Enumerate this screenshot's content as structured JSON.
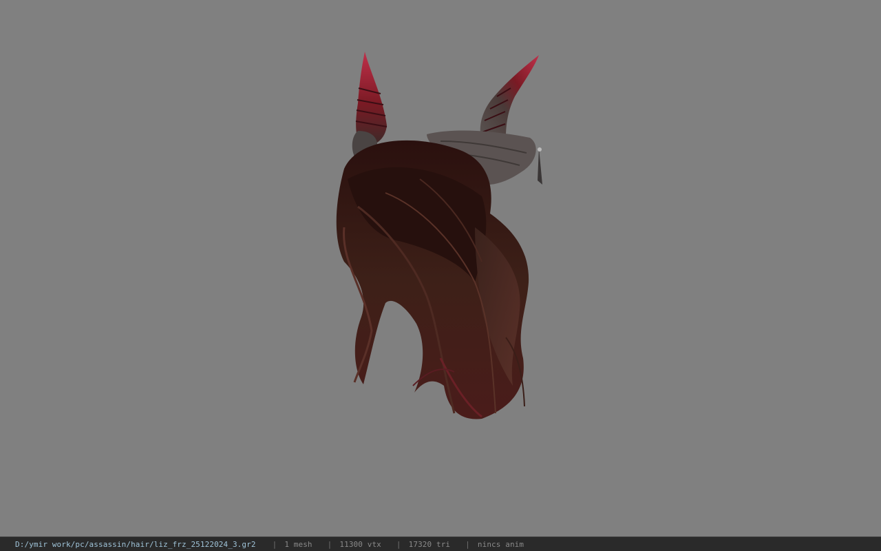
{
  "viewer": {
    "background_color": "#808080",
    "model_name": "hair-with-horns-model"
  },
  "status_bar": {
    "file_path": "D:/ymir work/pc/assassin/hair/liz_frz_25122024_3.gr2",
    "separator": "|",
    "mesh_count": "1 mesh",
    "vertex_count": "11300 vtx",
    "triangle_count": "17320 tri",
    "animation": "nincs anim"
  }
}
